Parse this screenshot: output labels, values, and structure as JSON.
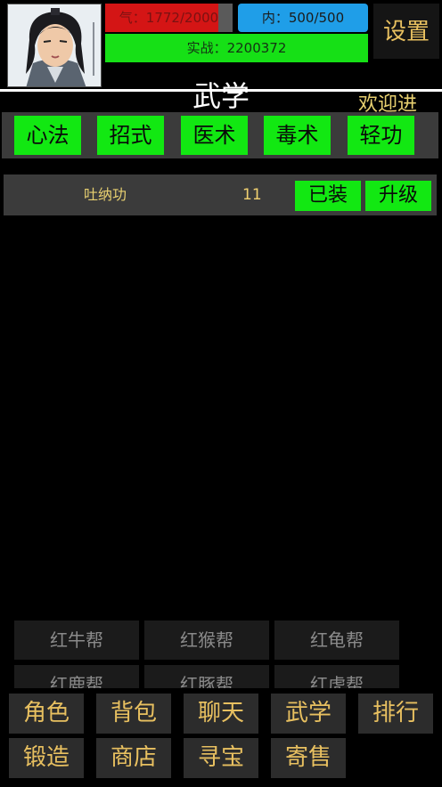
{
  "header": {
    "hp_text": "气：1772/2000",
    "hp_fraction": 0.886,
    "mp_text": "内：500/500",
    "exp_text": "实战：2200372",
    "settings_label": "设置"
  },
  "page": {
    "title": "武学",
    "marquee": "欢迎进"
  },
  "tabs": [
    {
      "label": "心法"
    },
    {
      "label": "招式"
    },
    {
      "label": "医术"
    },
    {
      "label": "毒术"
    },
    {
      "label": "轻功"
    }
  ],
  "skill": {
    "name": "吐纳功",
    "level": "11",
    "equipped_label": "已装",
    "upgrade_label": "升级"
  },
  "gangs": [
    {
      "label": "红牛帮"
    },
    {
      "label": "红猴帮"
    },
    {
      "label": "红龟帮"
    },
    {
      "label": "红鹿帮"
    },
    {
      "label": "红豚帮"
    },
    {
      "label": "红虎帮"
    }
  ],
  "nav": [
    {
      "label": "角色"
    },
    {
      "label": "背包"
    },
    {
      "label": "聊天"
    },
    {
      "label": "武学"
    },
    {
      "label": "排行"
    },
    {
      "label": "锻造"
    },
    {
      "label": "商店"
    },
    {
      "label": "寻宝"
    },
    {
      "label": "寄售"
    }
  ],
  "colors": {
    "hp": "#d41515",
    "mp": "#1f9ee8",
    "exp": "#16e016",
    "tab": "#12e812",
    "gold_text": "#e8c060"
  }
}
